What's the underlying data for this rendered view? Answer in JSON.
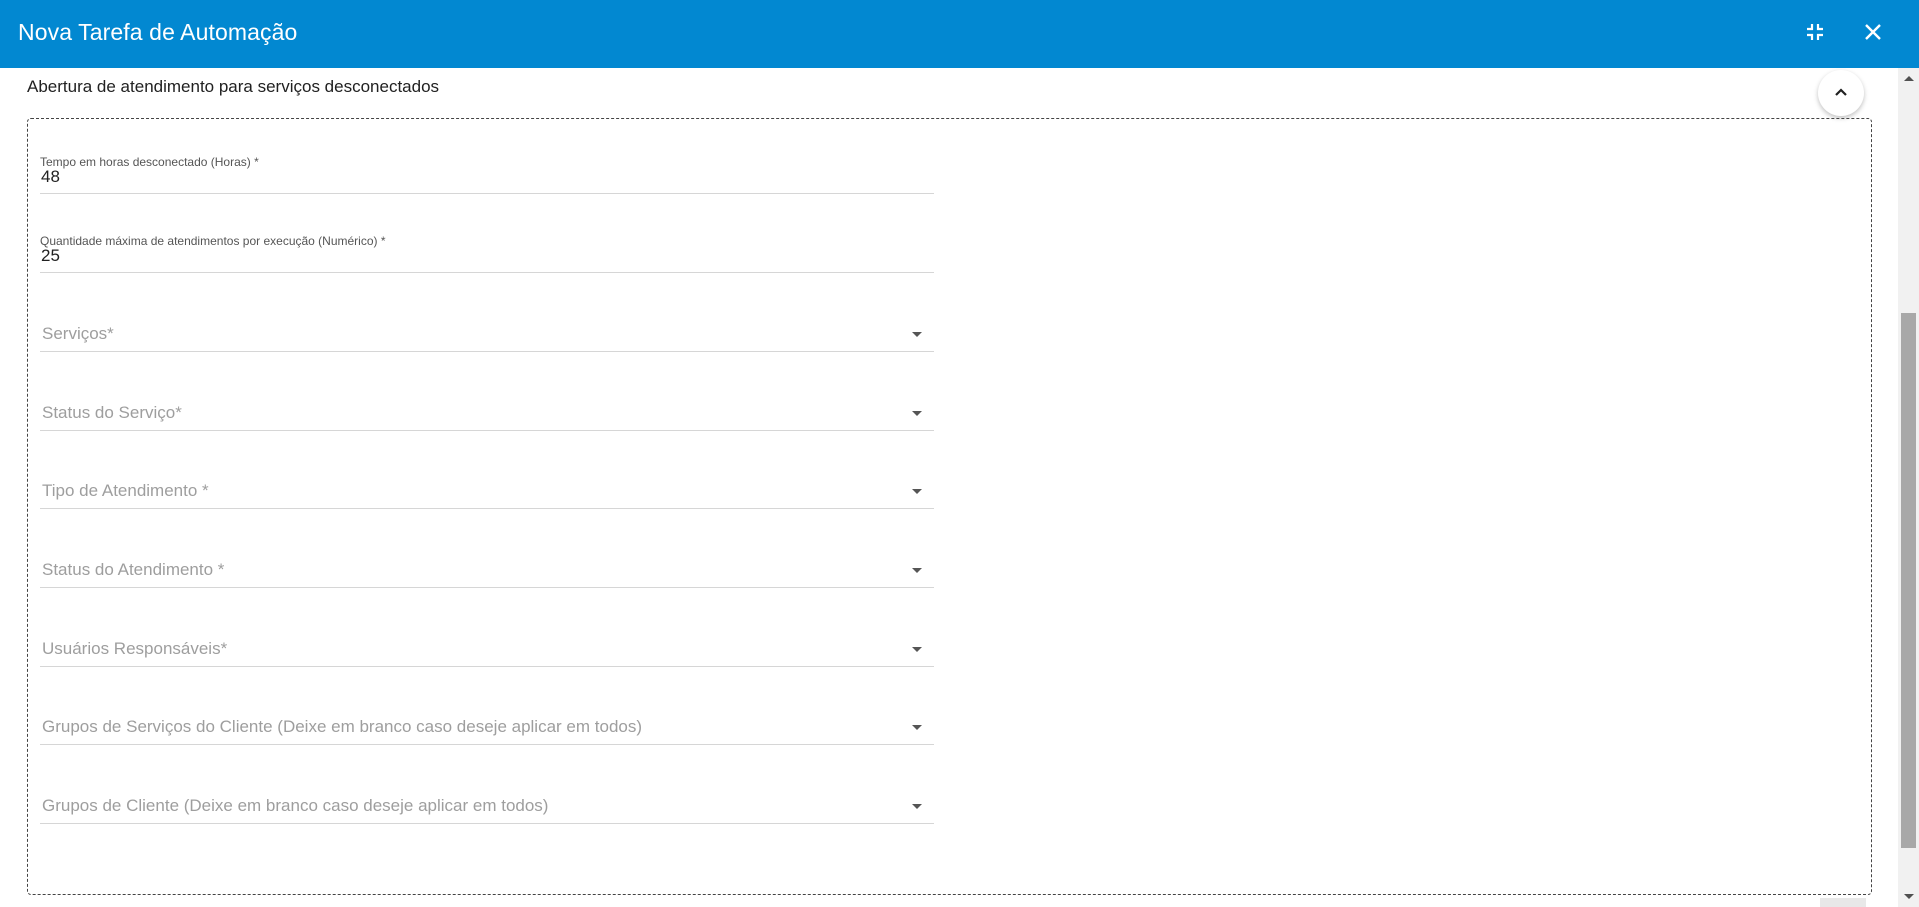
{
  "header": {
    "title": "Nova Tarefa de Automação",
    "background": "#0288d1",
    "icons": {
      "compress": "compress-icon",
      "close": "close-icon"
    }
  },
  "section": {
    "title": "Abertura de atendimento para serviços desconectados",
    "collapse_icon": "chevron-up-icon"
  },
  "fields": {
    "hours_label": "Tempo em horas desconectado (Horas) *",
    "hours_value": "48",
    "max_label": "Quantidade máxima de atendimentos por execução (Numérico) *",
    "max_value": "25"
  },
  "selects": [
    {
      "placeholder": "Serviços*"
    },
    {
      "placeholder": "Status do Serviço*"
    },
    {
      "placeholder": "Tipo de Atendimento *"
    },
    {
      "placeholder": "Status do Atendimento *"
    },
    {
      "placeholder": "Usuários Responsáveis*"
    },
    {
      "placeholder": "Grupos de Serviços do Cliente (Deixe em branco caso deseje aplicar em todos)"
    },
    {
      "placeholder": "Grupos de Cliente (Deixe em branco caso deseje aplicar em todos)"
    }
  ]
}
